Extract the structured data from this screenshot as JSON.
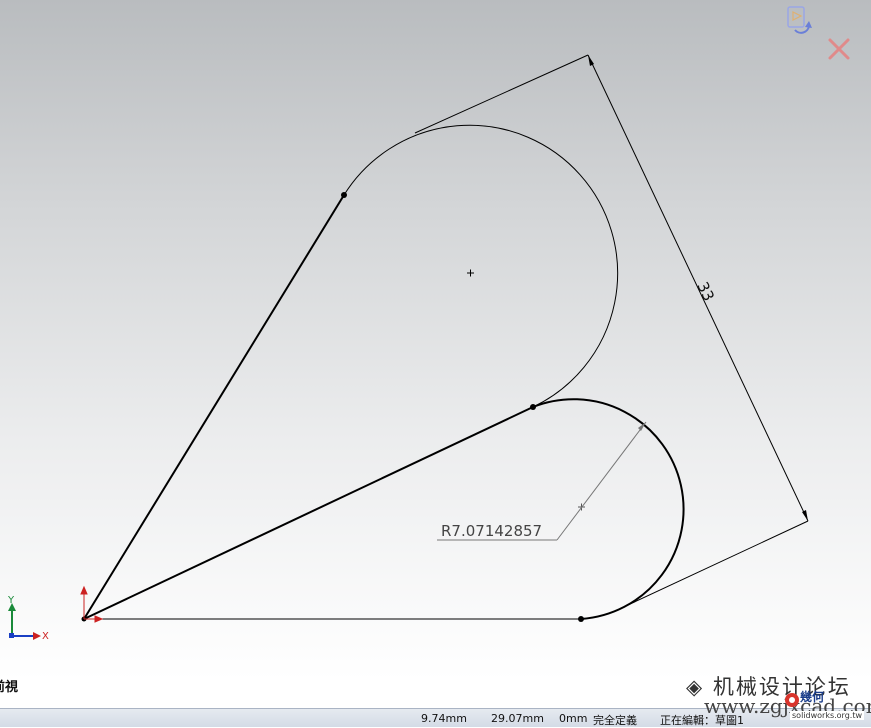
{
  "dimension": {
    "distance_value": "33",
    "radius_value": "R7.07142857"
  },
  "triad": {
    "x_label": "X",
    "y_label": "Y"
  },
  "view": {
    "label": "前視"
  },
  "watermark": {
    "forum_text": "机械设计论坛",
    "url_text": "www.zgjxcad.com"
  },
  "logo": {
    "brand_text": "幾何",
    "site_text": "solidworks.org.tw"
  },
  "status_bar": {
    "x_coord": "9.74mm",
    "y_coord": "29.07mm",
    "z_coord": "0mm",
    "definition_state": "完全定義",
    "editing": "正在編輯：草圖1"
  },
  "colors": {
    "geometry": "#000000",
    "triad_x": "#cc2222",
    "triad_y": "#1a8a3a",
    "triad_z": "#1a3fc4",
    "confirm_icon": "#6a7fd8",
    "cancel_icon": "#e08a8a"
  },
  "icons": {
    "confirm": "sketch-exit-icon",
    "cancel": "sketch-cancel-icon",
    "triad": "coordinate-triad-icon",
    "origin": "origin-icon"
  }
}
